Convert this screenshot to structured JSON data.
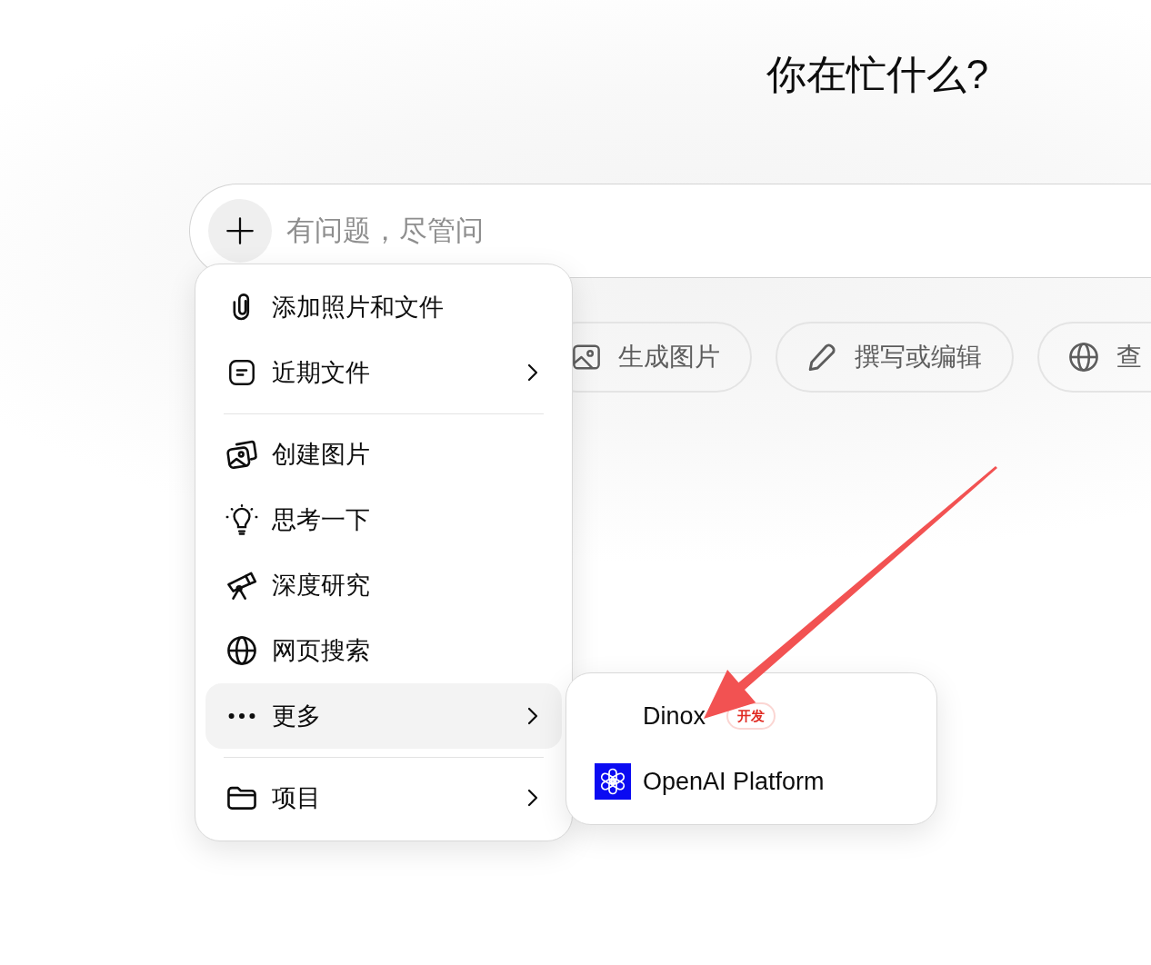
{
  "heading": "你在忙什么?",
  "composer": {
    "placeholder": "有问题，尽管问"
  },
  "suggestions": [
    {
      "kind": "image",
      "label": "生成图片"
    },
    {
      "kind": "write",
      "label": "撰写或编辑"
    },
    {
      "kind": "search",
      "label": "查"
    }
  ],
  "menu": {
    "sections": [
      {
        "items": [
          {
            "kind": "attach",
            "label": "添加照片和文件",
            "selected": false,
            "has_submenu": false
          },
          {
            "kind": "recent",
            "label": "近期文件",
            "selected": false,
            "has_submenu": true
          }
        ]
      },
      {
        "items": [
          {
            "kind": "image",
            "label": "创建图片",
            "selected": false,
            "has_submenu": false
          },
          {
            "kind": "think",
            "label": "思考一下",
            "selected": false,
            "has_submenu": false
          },
          {
            "kind": "research",
            "label": "深度研究",
            "selected": false,
            "has_submenu": false
          },
          {
            "kind": "web",
            "label": "网页搜索",
            "selected": false,
            "has_submenu": false
          },
          {
            "kind": "more",
            "label": "更多",
            "selected": true,
            "has_submenu": true
          }
        ]
      },
      {
        "items": [
          {
            "kind": "project",
            "label": "项目",
            "selected": false,
            "has_submenu": true
          }
        ]
      }
    ]
  },
  "submenu": {
    "items": [
      {
        "kind": "plain",
        "label": "Dinox",
        "badge": "开发",
        "selected": false
      },
      {
        "kind": "logo",
        "label": "OpenAI Platform",
        "selected": false
      }
    ]
  },
  "annotations": [
    {
      "kind": "arrow"
    }
  ]
}
